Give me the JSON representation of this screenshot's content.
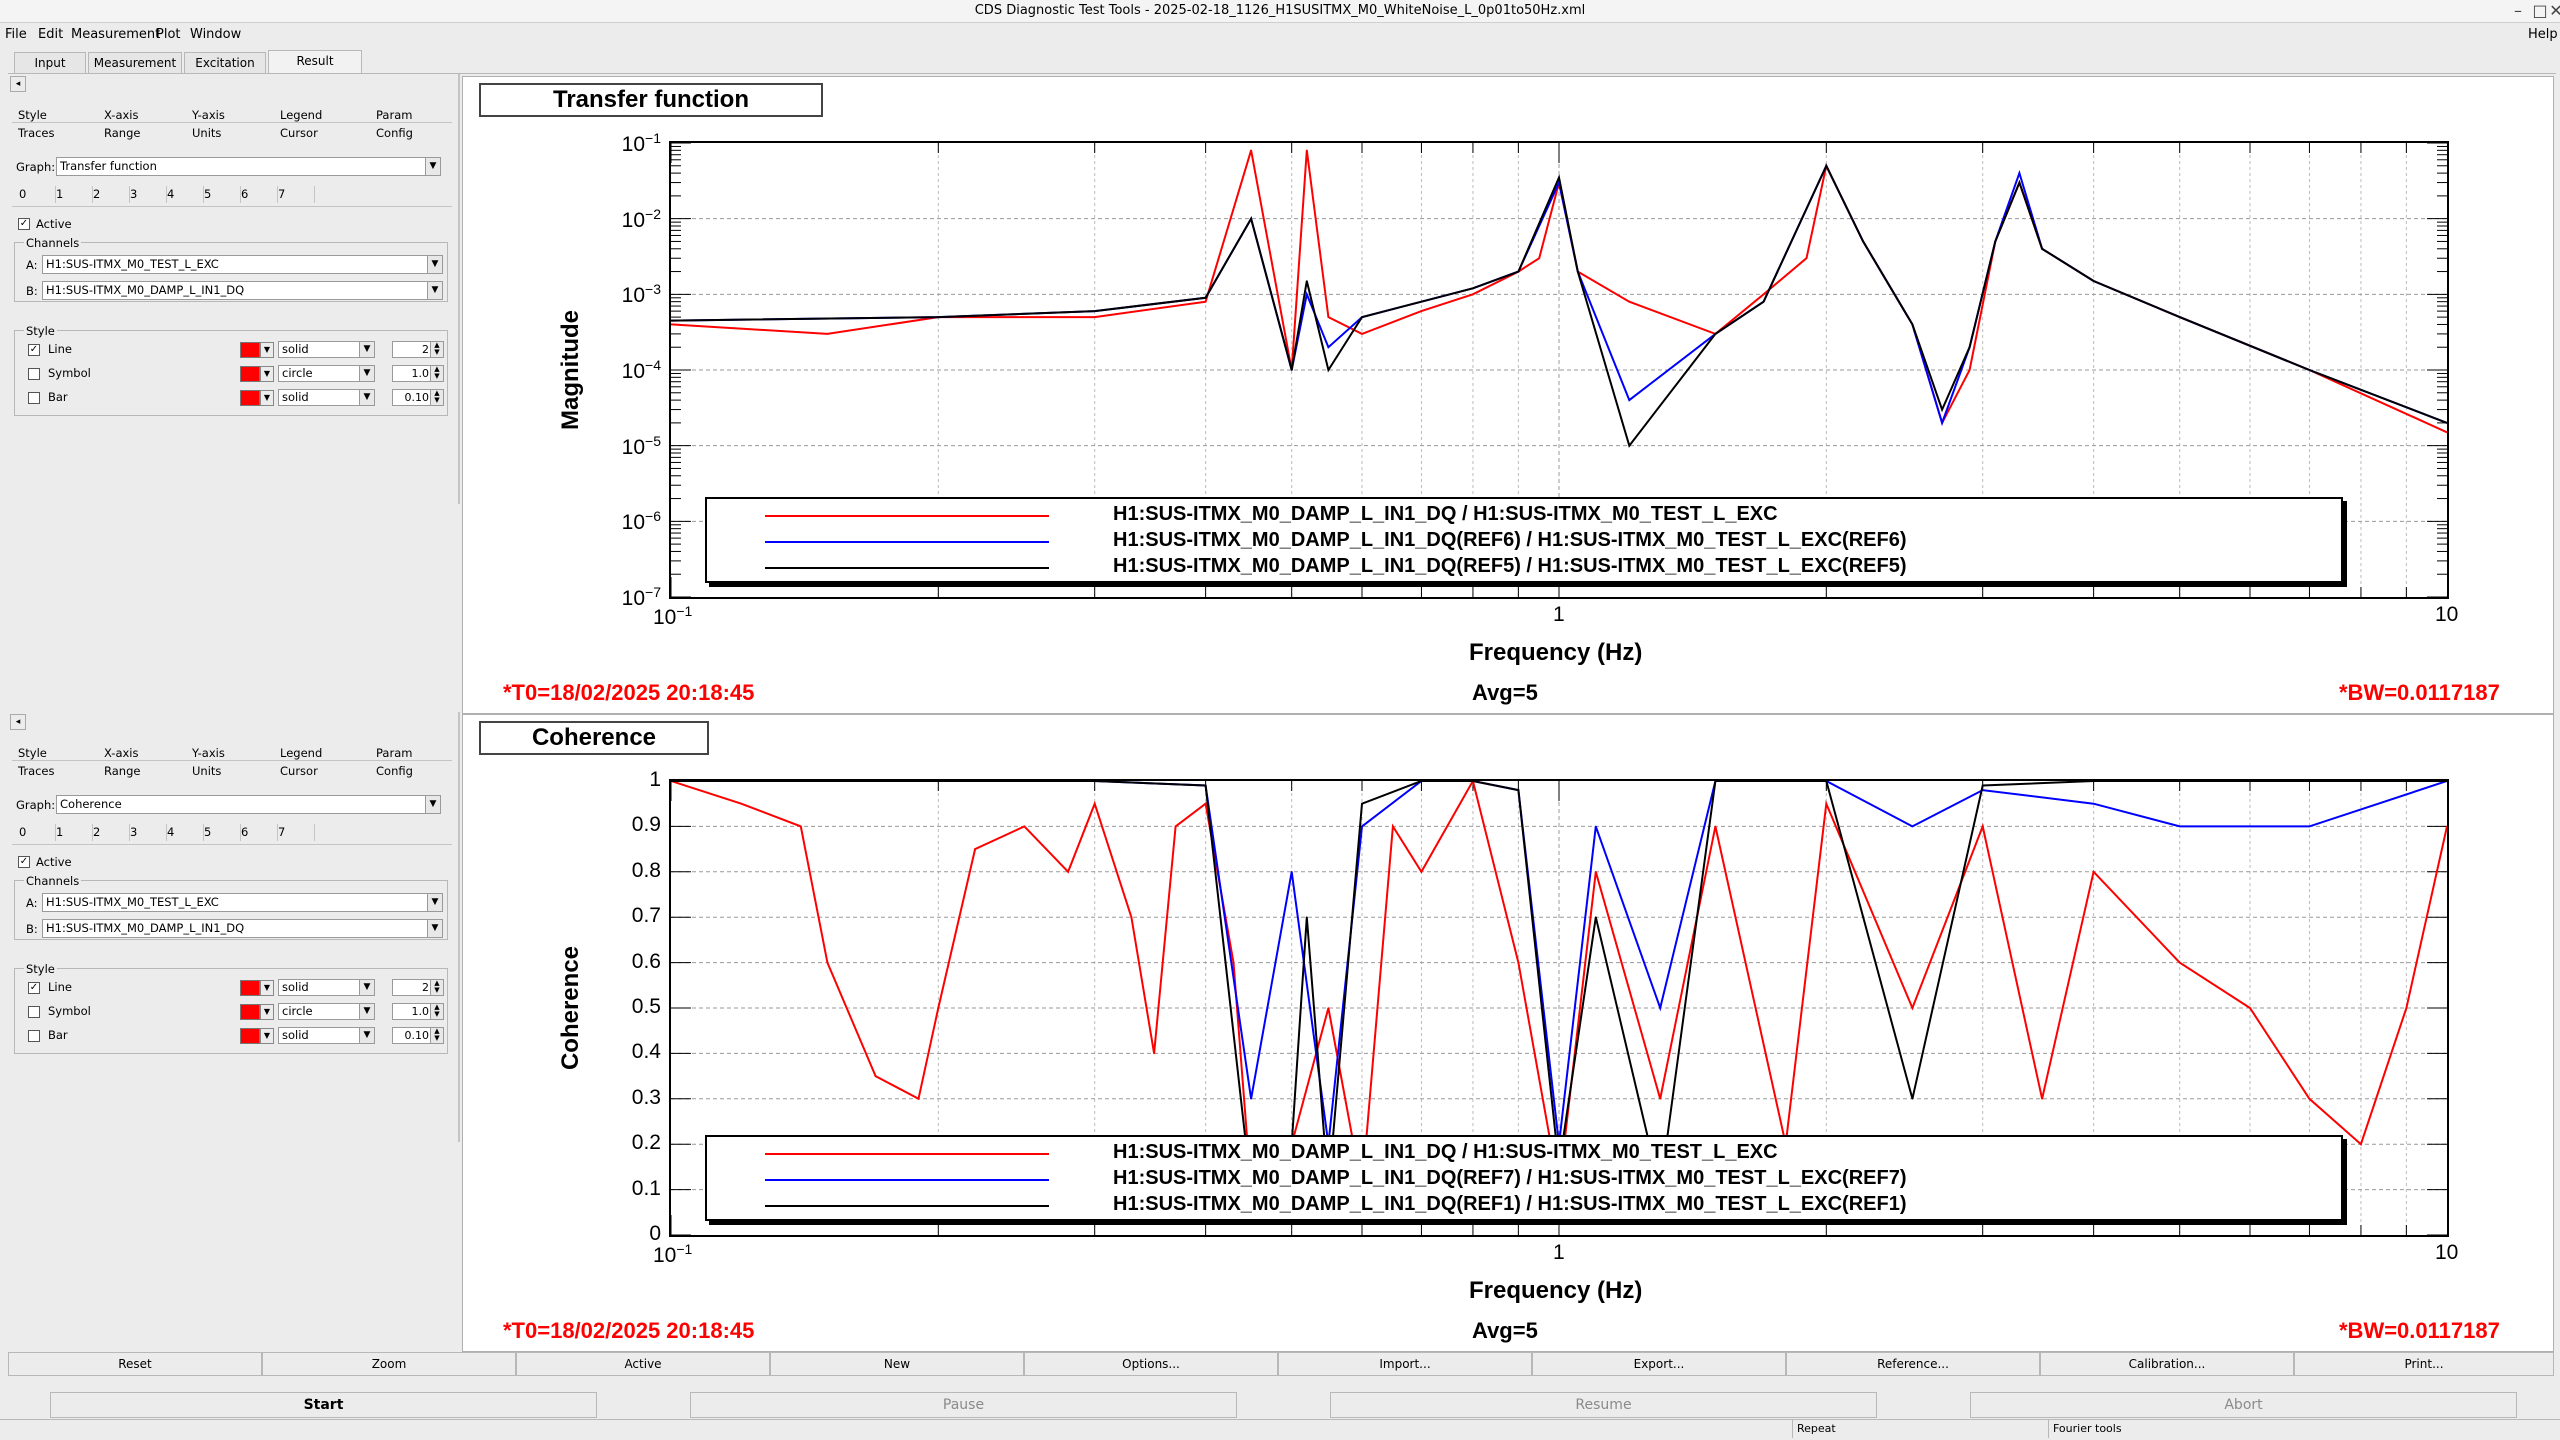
{
  "window": {
    "title": "CDS Diagnostic Test Tools - 2025-02-18_1126_H1SUSITMX_M0_WhiteNoise_L_0p01to50Hz.xml"
  },
  "menu": [
    "File",
    "Edit",
    "Measurement",
    "Plot",
    "Window"
  ],
  "help": "Help",
  "tabs": [
    "Input",
    "Measurement",
    "Excitation",
    "Result"
  ],
  "panels": [
    {
      "subtabs_row1": [
        "Style",
        "X-axis",
        "Y-axis",
        "Legend",
        "Param"
      ],
      "subtabs_row2": [
        "Traces",
        "Range",
        "Units",
        "Cursor",
        "Config"
      ],
      "graph_label": "Graph:",
      "graph_value": "Transfer function",
      "trace_tabs": [
        "0",
        "1",
        "2",
        "3",
        "4",
        "5",
        "6",
        "7"
      ],
      "active_label": "Active",
      "channels_label": "Channels",
      "channel_a_label": "A:",
      "channel_a": "H1:SUS-ITMX_M0_TEST_L_EXC",
      "channel_b_label": "B:",
      "channel_b": "H1:SUS-ITMX_M0_DAMP_L_IN1_DQ",
      "style_label": "Style",
      "style_rows": [
        {
          "name": "Line",
          "checked": true,
          "kind": "solid",
          "value": "2"
        },
        {
          "name": "Symbol",
          "checked": false,
          "kind": "circle",
          "value": "1.0"
        },
        {
          "name": "Bar",
          "checked": false,
          "kind": "solid",
          "value": "0.10"
        }
      ]
    },
    {
      "subtabs_row1": [
        "Style",
        "X-axis",
        "Y-axis",
        "Legend",
        "Param"
      ],
      "subtabs_row2": [
        "Traces",
        "Range",
        "Units",
        "Cursor",
        "Config"
      ],
      "graph_label": "Graph:",
      "graph_value": "Coherence",
      "trace_tabs": [
        "0",
        "1",
        "2",
        "3",
        "4",
        "5",
        "6",
        "7"
      ],
      "active_label": "Active",
      "channels_label": "Channels",
      "channel_a_label": "A:",
      "channel_a": "H1:SUS-ITMX_M0_TEST_L_EXC",
      "channel_b_label": "B:",
      "channel_b": "H1:SUS-ITMX_M0_DAMP_L_IN1_DQ",
      "style_label": "Style",
      "style_rows": [
        {
          "name": "Line",
          "checked": true,
          "kind": "solid",
          "value": "2"
        },
        {
          "name": "Symbol",
          "checked": false,
          "kind": "circle",
          "value": "1.0"
        },
        {
          "name": "Bar",
          "checked": false,
          "kind": "solid",
          "value": "0.10"
        }
      ]
    }
  ],
  "plots": [
    {
      "title": "Transfer function",
      "ylabel": "Magnitude",
      "xlabel": "Frequency (Hz)",
      "yticks": [
        {
          "base": "10",
          "exp": "−1"
        },
        {
          "base": "10",
          "exp": "−2"
        },
        {
          "base": "10",
          "exp": "−3"
        },
        {
          "base": "10",
          "exp": "−4"
        },
        {
          "base": "10",
          "exp": "−5"
        },
        {
          "base": "10",
          "exp": "−6"
        },
        {
          "base": "10",
          "exp": "−7"
        }
      ],
      "xticks": [
        {
          "base": "10",
          "exp": "−1"
        },
        {
          "base": "1",
          "exp": ""
        },
        {
          "base": "10",
          "exp": ""
        }
      ],
      "legend": [
        {
          "color": "#ff0000",
          "text": "H1:SUS-ITMX_M0_DAMP_L_IN1_DQ / H1:SUS-ITMX_M0_TEST_L_EXC"
        },
        {
          "color": "#0000ff",
          "text": "H1:SUS-ITMX_M0_DAMP_L_IN1_DQ(REF6) / H1:SUS-ITMX_M0_TEST_L_EXC(REF6)"
        },
        {
          "color": "#000000",
          "text": "H1:SUS-ITMX_M0_DAMP_L_IN1_DQ(REF5) / H1:SUS-ITMX_M0_TEST_L_EXC(REF5)"
        }
      ],
      "t0": "*T0=18/02/2025 20:18:45",
      "avg": "Avg=5",
      "bw": "*BW=0.0117187"
    },
    {
      "title": "Coherence",
      "ylabel": "Coherence",
      "xlabel": "Frequency (Hz)",
      "yticks": [
        {
          "base": "1",
          "exp": ""
        },
        {
          "base": "0.9",
          "exp": ""
        },
        {
          "base": "0.8",
          "exp": ""
        },
        {
          "base": "0.7",
          "exp": ""
        },
        {
          "base": "0.6",
          "exp": ""
        },
        {
          "base": "0.5",
          "exp": ""
        },
        {
          "base": "0.4",
          "exp": ""
        },
        {
          "base": "0.3",
          "exp": ""
        },
        {
          "base": "0.2",
          "exp": ""
        },
        {
          "base": "0.1",
          "exp": ""
        },
        {
          "base": "0",
          "exp": ""
        }
      ],
      "xticks": [
        {
          "base": "10",
          "exp": "−1"
        },
        {
          "base": "1",
          "exp": ""
        },
        {
          "base": "10",
          "exp": ""
        }
      ],
      "legend": [
        {
          "color": "#ff0000",
          "text": "H1:SUS-ITMX_M0_DAMP_L_IN1_DQ / H1:SUS-ITMX_M0_TEST_L_EXC"
        },
        {
          "color": "#0000ff",
          "text": "H1:SUS-ITMX_M0_DAMP_L_IN1_DQ(REF7) / H1:SUS-ITMX_M0_TEST_L_EXC(REF7)"
        },
        {
          "color": "#000000",
          "text": "H1:SUS-ITMX_M0_DAMP_L_IN1_DQ(REF1) / H1:SUS-ITMX_M0_TEST_L_EXC(REF1)"
        }
      ],
      "t0": "*T0=18/02/2025 20:18:45",
      "avg": "Avg=5",
      "bw": "*BW=0.0117187"
    }
  ],
  "chart_data": [
    {
      "type": "line",
      "title": "Transfer function",
      "xlabel": "Frequency (Hz)",
      "ylabel": "Magnitude",
      "xscale": "log",
      "yscale": "log",
      "xlim": [
        0.1,
        10
      ],
      "ylim": [
        1e-07,
        0.1
      ],
      "grid": true,
      "legend_position": "bottom",
      "series": [
        {
          "name": "H1:SUS-ITMX_M0_DAMP_L_IN1_DQ / H1:SUS-ITMX_M0_TEST_L_EXC",
          "color": "#ff0000",
          "x": [
            0.1,
            0.15,
            0.2,
            0.3,
            0.4,
            0.45,
            0.5,
            0.52,
            0.55,
            0.6,
            0.7,
            0.8,
            0.9,
            0.95,
            1.0,
            1.05,
            1.2,
            1.5,
            1.7,
            1.9,
            2.0,
            2.2,
            2.5,
            2.7,
            2.9,
            3.1,
            3.3,
            3.5,
            4,
            5,
            7,
            10
          ],
          "y": [
            0.0004,
            0.0003,
            0.0005,
            0.0005,
            0.0008,
            0.08,
            0.0001,
            0.08,
            0.0005,
            0.0003,
            0.0006,
            0.001,
            0.002,
            0.003,
            0.03,
            0.002,
            0.0008,
            0.0003,
            0.001,
            0.003,
            0.05,
            0.005,
            0.0004,
            2e-05,
            0.0001,
            0.005,
            0.03,
            0.004,
            0.0015,
            0.0005,
            0.0001,
            1.5e-05
          ]
        },
        {
          "name": "H1:SUS-ITMX_M0_DAMP_L_IN1_DQ(REF6) / H1:SUS-ITMX_M0_TEST_L_EXC(REF6)",
          "color": "#0000ff",
          "x": [
            0.1,
            0.2,
            0.3,
            0.4,
            0.45,
            0.5,
            0.52,
            0.55,
            0.6,
            0.7,
            0.8,
            0.9,
            1.0,
            1.05,
            1.2,
            1.5,
            1.7,
            2.0,
            2.2,
            2.5,
            2.7,
            2.9,
            3.1,
            3.3,
            3.5,
            4,
            5,
            7,
            10
          ],
          "y": [
            0.00045,
            0.0005,
            0.0006,
            0.0009,
            0.01,
            0.0001,
            0.001,
            0.0002,
            0.0005,
            0.0008,
            0.0012,
            0.002,
            0.03,
            0.002,
            4e-05,
            0.0003,
            0.0008,
            0.05,
            0.005,
            0.0004,
            2e-05,
            0.0002,
            0.005,
            0.04,
            0.004,
            0.0015,
            0.0005,
            0.0001,
            2e-05
          ]
        },
        {
          "name": "H1:SUS-ITMX_M0_DAMP_L_IN1_DQ(REF5) / H1:SUS-ITMX_M0_TEST_L_EXC(REF5)",
          "color": "#000000",
          "x": [
            0.1,
            0.2,
            0.3,
            0.4,
            0.45,
            0.5,
            0.52,
            0.55,
            0.6,
            0.7,
            0.8,
            0.9,
            1.0,
            1.05,
            1.2,
            1.5,
            1.7,
            2.0,
            2.2,
            2.5,
            2.7,
            2.9,
            3.1,
            3.3,
            3.5,
            4,
            5,
            7,
            10
          ],
          "y": [
            0.00045,
            0.0005,
            0.0006,
            0.0009,
            0.01,
            0.0001,
            0.0015,
            0.0001,
            0.0005,
            0.0008,
            0.0012,
            0.002,
            0.035,
            0.002,
            1e-05,
            0.0003,
            0.0008,
            0.05,
            0.005,
            0.0004,
            3e-05,
            0.0002,
            0.005,
            0.03,
            0.004,
            0.0015,
            0.0005,
            0.0001,
            2e-05
          ]
        }
      ]
    },
    {
      "type": "line",
      "title": "Coherence",
      "xlabel": "Frequency (Hz)",
      "ylabel": "Coherence",
      "xscale": "log",
      "yscale": "linear",
      "xlim": [
        0.1,
        10
      ],
      "ylim": [
        0,
        1
      ],
      "grid": true,
      "legend_position": "bottom",
      "series": [
        {
          "name": "H1:SUS-ITMX_M0_DAMP_L_IN1_DQ / H1:SUS-ITMX_M0_TEST_L_EXC",
          "color": "#ff0000",
          "x": [
            0.1,
            0.12,
            0.14,
            0.15,
            0.17,
            0.19,
            0.2,
            0.22,
            0.25,
            0.28,
            0.3,
            0.33,
            0.35,
            0.37,
            0.4,
            0.43,
            0.45,
            0.5,
            0.55,
            0.6,
            0.65,
            0.7,
            0.8,
            0.9,
            1.0,
            1.1,
            1.3,
            1.5,
            1.8,
            2.0,
            2.5,
            3,
            3.5,
            4,
            5,
            6,
            7,
            8,
            9,
            10
          ],
          "y": [
            1,
            0.95,
            0.9,
            0.6,
            0.35,
            0.3,
            0.5,
            0.85,
            0.9,
            0.8,
            0.95,
            0.7,
            0.4,
            0.9,
            0.95,
            0.6,
            0.1,
            0.2,
            0.5,
            0.1,
            0.9,
            0.8,
            1,
            0.6,
            0.1,
            0.8,
            0.3,
            0.9,
            0.2,
            0.95,
            0.5,
            0.9,
            0.3,
            0.8,
            0.6,
            0.5,
            0.3,
            0.2,
            0.5,
            0.9
          ]
        },
        {
          "name": "H1:SUS-ITMX_M0_DAMP_L_IN1_DQ(REF7) / H1:SUS-ITMX_M0_TEST_L_EXC(REF7)",
          "color": "#0000ff",
          "x": [
            0.1,
            0.2,
            0.3,
            0.4,
            0.45,
            0.5,
            0.55,
            0.6,
            0.7,
            0.8,
            0.9,
            1.0,
            1.1,
            1.3,
            1.5,
            2.0,
            2.5,
            3,
            4,
            5,
            7,
            10
          ],
          "y": [
            1,
            1,
            1,
            0.99,
            0.3,
            0.8,
            0.2,
            0.9,
            1,
            1,
            0.98,
            0.2,
            0.9,
            0.5,
            1,
            1,
            0.9,
            0.98,
            0.95,
            0.9,
            0.9,
            1
          ]
        },
        {
          "name": "H1:SUS-ITMX_M0_DAMP_L_IN1_DQ(REF1) / H1:SUS-ITMX_M0_TEST_L_EXC(REF1)",
          "color": "#000000",
          "x": [
            0.1,
            0.2,
            0.3,
            0.4,
            0.45,
            0.5,
            0.52,
            0.55,
            0.6,
            0.7,
            0.8,
            0.9,
            1.0,
            1.1,
            1.3,
            1.5,
            2.0,
            2.5,
            3,
            4,
            5,
            7,
            10
          ],
          "y": [
            1,
            1,
            1,
            0.99,
            0.1,
            0.2,
            0.7,
            0.1,
            0.95,
            1,
            1,
            0.98,
            0.15,
            0.7,
            0.1,
            1,
            1,
            0.3,
            0.99,
            1,
            1,
            1,
            1
          ]
        }
      ]
    }
  ],
  "buttons": [
    "Reset",
    "Zoom",
    "Active",
    "New",
    "Options...",
    "Import...",
    "Export...",
    "Reference...",
    "Calibration...",
    "Print..."
  ],
  "run_buttons": [
    "Start",
    "Pause",
    "Resume",
    "Abort"
  ],
  "statusbar": [
    "Repeat",
    "Fourier tools"
  ]
}
